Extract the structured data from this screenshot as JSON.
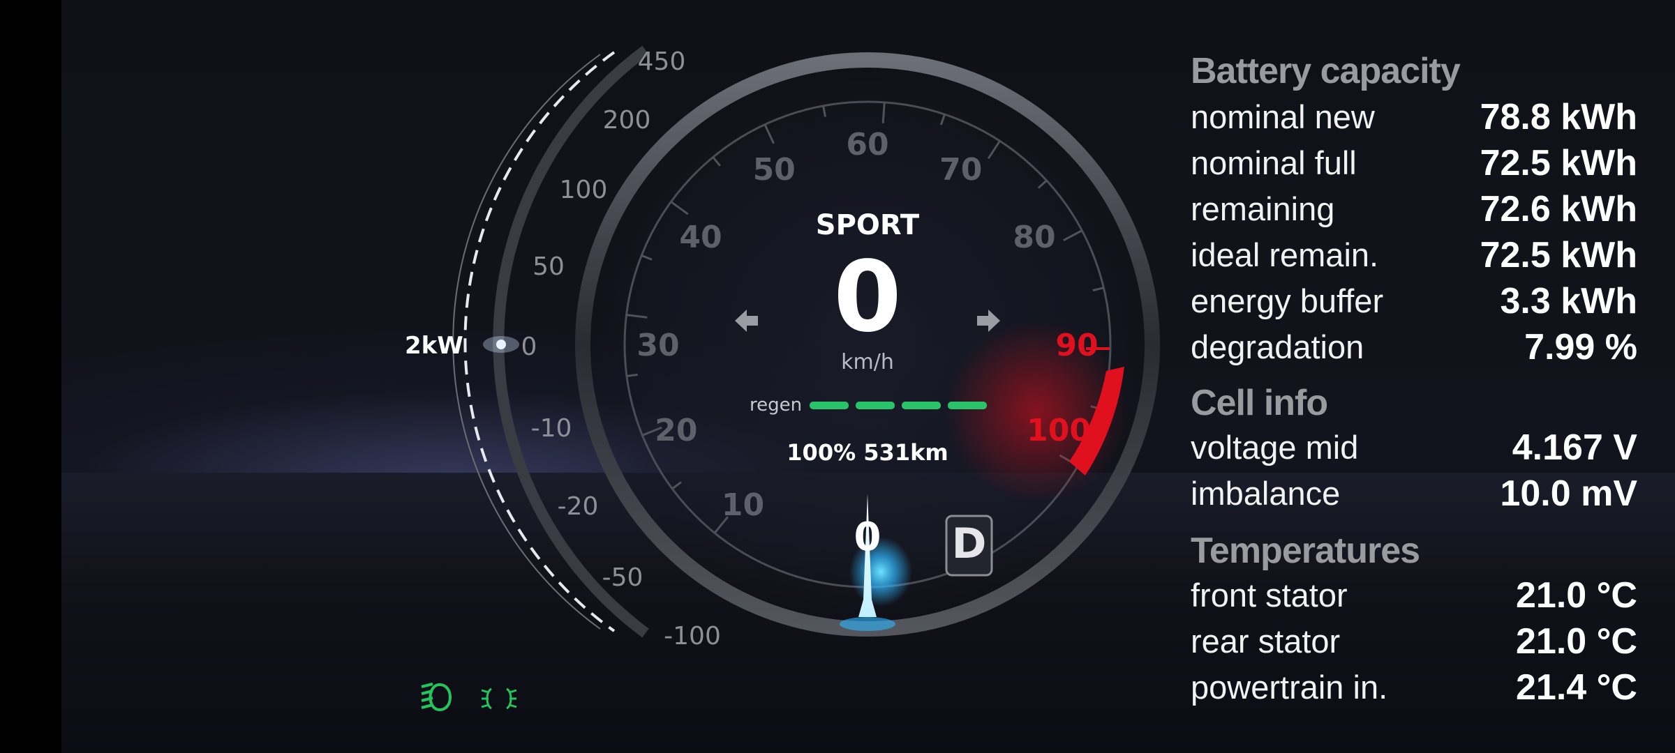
{
  "speedometer": {
    "mode": "SPORT",
    "speed": "0",
    "speed_unit": "km/h",
    "regen_label": "regen",
    "charge_range": "100% 531km",
    "gear": "D",
    "needle_label": "0",
    "power_readout": "2kW",
    "speed_ticks": [
      "10",
      "20",
      "30",
      "40",
      "50",
      "60",
      "70",
      "80",
      "90",
      "100"
    ],
    "power_ticks": [
      "450",
      "200",
      "100",
      "50",
      "0",
      "-10",
      "-20",
      "-50",
      "-100"
    ],
    "regen_level": 1.0
  },
  "battery_capacity": {
    "title": "Battery capacity",
    "rows": [
      {
        "label": "nominal new",
        "value": "78.8 kWh"
      },
      {
        "label": "nominal full",
        "value": "72.5 kWh"
      },
      {
        "label": "remaining",
        "value": "72.6 kWh"
      },
      {
        "label": "ideal remain.",
        "value": "72.5 kWh"
      },
      {
        "label": "energy buffer",
        "value": "3.3 kWh"
      },
      {
        "label": "degradation",
        "value": "7.99 %"
      }
    ]
  },
  "cell_info": {
    "title": "Cell info",
    "rows": [
      {
        "label": "voltage mid",
        "value": "4.167 V"
      },
      {
        "label": "imbalance",
        "value": "10.0 mV"
      }
    ]
  },
  "temperatures": {
    "title": "Temperatures",
    "rows": [
      {
        "label": "front stator",
        "value": "21.0 °C"
      },
      {
        "label": "rear stator",
        "value": "21.0 °C"
      },
      {
        "label": "powertrain in.",
        "value": "21.4 °C"
      }
    ]
  },
  "indicators": {
    "low_beam_icon": "low-beam-headlight-icon",
    "parking_lights_icon": "parking-lights-icon",
    "indicator_color": "#22c55e"
  },
  "colors": {
    "accent_red": "#e0101e",
    "regen_green": "#29c46a",
    "needle_glow": "#2fb7ff"
  }
}
